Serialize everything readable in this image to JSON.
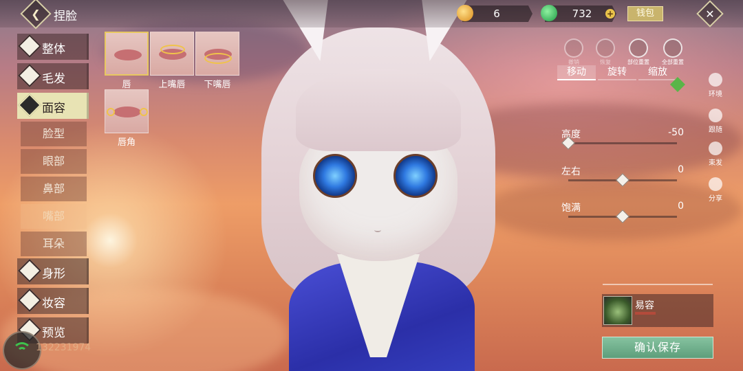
{
  "header": {
    "title": "捏脸",
    "gold_amount": "6",
    "jade_amount": "732",
    "wallet_label": "钱包"
  },
  "categories": [
    {
      "label": "整体",
      "icon": "body-icon"
    },
    {
      "label": "毛发",
      "icon": "hair-icon"
    },
    {
      "label": "面容",
      "icon": "face-icon",
      "active": true
    },
    {
      "label": "身形",
      "icon": "figure-icon"
    },
    {
      "label": "妆容",
      "icon": "makeup-icon"
    },
    {
      "label": "预览",
      "icon": "preview-icon"
    }
  ],
  "subcategories": [
    {
      "label": "脸型"
    },
    {
      "label": "眼部"
    },
    {
      "label": "鼻部"
    },
    {
      "label": "嘴部",
      "active": true
    },
    {
      "label": "耳朵"
    }
  ],
  "parts": [
    {
      "label": "唇",
      "selected": true
    },
    {
      "label": "上嘴唇"
    },
    {
      "label": "下嘴唇"
    },
    {
      "label": "唇角"
    }
  ],
  "tools": {
    "undo": "撤销",
    "redo": "恢复",
    "reset_part": "部位重置",
    "reset_all": "全部重置"
  },
  "tabs": [
    "移动",
    "旋转",
    "缩放"
  ],
  "side_tools": [
    "环境",
    "跟随",
    "束发",
    "分享"
  ],
  "sliders": [
    {
      "label": "高度",
      "value": "-50",
      "level": 0
    },
    {
      "label": "左右",
      "value": "0",
      "level": 0.5
    },
    {
      "label": "饱满",
      "value": "0",
      "level": 0.5
    }
  ],
  "card": {
    "label": "易容"
  },
  "confirm_label": "确认保存",
  "player_id": "132231974",
  "colors": {
    "accent_gold": "#e8c860",
    "confirm_green": "#6fae8a",
    "active_tab": "#e8e3b4"
  }
}
